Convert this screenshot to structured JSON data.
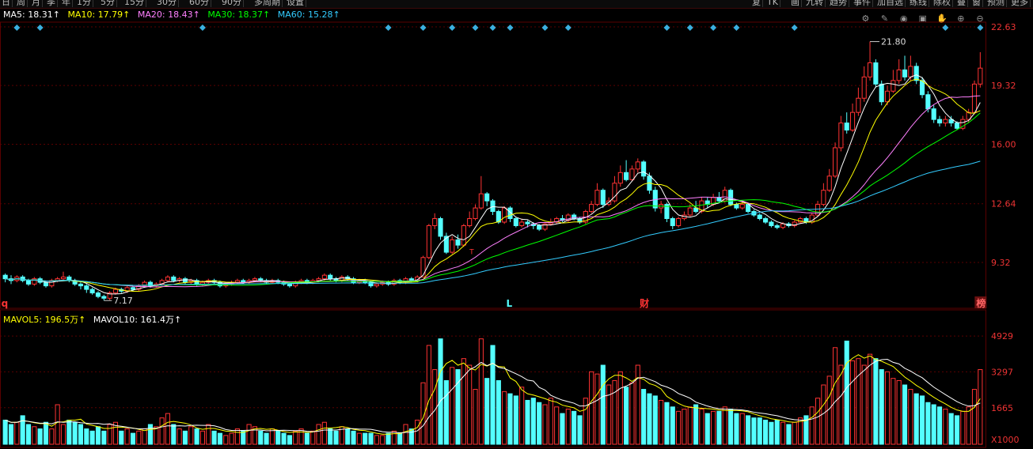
{
  "toolbar": {
    "left_items": [
      "日",
      "周",
      "月",
      "季",
      "年",
      "1分",
      "5分",
      "15分",
      "30分",
      "60分",
      "90分",
      "多周期",
      "设置"
    ],
    "right_items": [
      "复",
      "TK",
      "画",
      "九转",
      "趋势",
      "事件",
      "加自选",
      "练线",
      "除权",
      "叠",
      "窗",
      "预测",
      "更多"
    ]
  },
  "ma_legend": {
    "ma5": "MA5: 18.31↑",
    "ma10": "MA10: 17.79↑",
    "ma20": "MA20: 18.43↑",
    "ma30": "MA30: 18.37↑",
    "ma60": "MA60: 15.28↑"
  },
  "vol_legend": {
    "mavol5": "MAVOL5: 196.5万↑",
    "mavol10": "MAVOL10: 161.4万↑"
  },
  "price_axis": [
    "22.63",
    "19.32",
    "16.00",
    "12.64",
    "9.32"
  ],
  "vol_axis": [
    "4929",
    "3297",
    "1665",
    "X1000"
  ],
  "annotations": {
    "high_label": "21.80",
    "low_label": "7.17",
    "marker_q": "q",
    "marker_l": "L",
    "marker_cai": "财",
    "marker_bang": "榜",
    "marker_t": "T"
  },
  "colors": {
    "up": "#ff3333",
    "down": "#54ffff",
    "ma5": "#ffffff",
    "ma10": "#ffff00",
    "ma20": "#ff80ff",
    "ma30": "#00ff00",
    "ma60": "#33ccff",
    "grid": "#5a0000"
  },
  "icons": [
    "settings-icon",
    "pen-icon",
    "eye-icon",
    "bag-icon",
    "hand-icon",
    "zoom-in-icon",
    "zoom-out-icon"
  ],
  "chart_data": {
    "type": "candlestick",
    "price_axis_ticks": [
      9.32,
      12.64,
      16.0,
      19.32,
      22.63
    ],
    "volume_axis_ticks": [
      1665,
      3297,
      4929
    ],
    "volume_unit": "X1000",
    "candles": [
      [
        8.6,
        8.4,
        8.7,
        8.2,
        1100
      ],
      [
        8.4,
        8.3,
        8.6,
        8.1,
        900
      ],
      [
        8.3,
        8.5,
        8.6,
        8.2,
        1000
      ],
      [
        8.5,
        8.3,
        8.6,
        8.2,
        1300
      ],
      [
        8.3,
        8.1,
        8.4,
        8.0,
        900
      ],
      [
        8.1,
        8.4,
        8.5,
        8.0,
        800
      ],
      [
        8.4,
        8.2,
        8.5,
        8.1,
        700
      ],
      [
        8.2,
        8.0,
        8.3,
        7.9,
        1000
      ],
      [
        8.0,
        8.3,
        8.4,
        7.9,
        700
      ],
      [
        8.3,
        8.4,
        8.5,
        8.2,
        1800
      ],
      [
        8.4,
        8.5,
        8.8,
        8.3,
        900
      ],
      [
        8.5,
        8.3,
        8.6,
        8.2,
        1100
      ],
      [
        8.3,
        8.1,
        8.4,
        8.0,
        1000
      ],
      [
        8.1,
        8.0,
        8.2,
        7.8,
        900
      ],
      [
        8.0,
        7.8,
        8.1,
        7.6,
        700
      ],
      [
        7.8,
        7.6,
        7.9,
        7.5,
        600
      ],
      [
        7.6,
        7.4,
        7.7,
        7.3,
        800
      ],
      [
        7.4,
        7.3,
        7.5,
        7.17,
        600
      ],
      [
        7.3,
        7.6,
        7.7,
        7.2,
        900
      ],
      [
        7.6,
        7.8,
        7.9,
        7.5,
        1000
      ],
      [
        7.8,
        7.7,
        7.9,
        7.6,
        600
      ],
      [
        7.7,
        7.9,
        8.0,
        7.6,
        700
      ],
      [
        7.9,
        7.8,
        8.0,
        7.7,
        500
      ],
      [
        7.8,
        8.0,
        8.1,
        7.7,
        600
      ],
      [
        8.0,
        8.2,
        8.3,
        7.9,
        700
      ],
      [
        8.2,
        8.0,
        8.3,
        7.9,
        900
      ],
      [
        8.0,
        8.1,
        8.2,
        7.9,
        800
      ],
      [
        8.1,
        8.3,
        8.4,
        8.0,
        1200
      ],
      [
        8.3,
        8.5,
        8.6,
        8.2,
        1400
      ],
      [
        8.5,
        8.3,
        8.6,
        8.2,
        900
      ],
      [
        8.3,
        8.4,
        8.5,
        8.2,
        700
      ],
      [
        8.4,
        8.2,
        8.5,
        8.1,
        600
      ],
      [
        8.2,
        8.3,
        8.4,
        8.1,
        800
      ],
      [
        8.3,
        8.1,
        8.4,
        8.0,
        700
      ],
      [
        8.1,
        8.2,
        8.3,
        8.0,
        600
      ],
      [
        8.2,
        8.3,
        8.4,
        8.1,
        900
      ],
      [
        8.3,
        8.2,
        8.4,
        8.1,
        600
      ],
      [
        8.2,
        8.0,
        8.3,
        7.9,
        500
      ],
      [
        8.0,
        8.1,
        8.2,
        7.9,
        400
      ],
      [
        8.1,
        8.2,
        8.3,
        8.0,
        500
      ],
      [
        8.2,
        8.3,
        8.4,
        8.1,
        700
      ],
      [
        8.3,
        8.2,
        8.4,
        8.1,
        600
      ],
      [
        8.2,
        8.3,
        8.4,
        8.1,
        900
      ],
      [
        8.3,
        8.4,
        8.5,
        8.2,
        800
      ],
      [
        8.4,
        8.3,
        8.5,
        8.2,
        600
      ],
      [
        8.3,
        8.2,
        8.4,
        8.1,
        500
      ],
      [
        8.2,
        8.3,
        8.4,
        8.1,
        700
      ],
      [
        8.3,
        8.2,
        8.4,
        8.1,
        600
      ],
      [
        8.2,
        8.1,
        8.3,
        8.0,
        500
      ],
      [
        8.1,
        8.0,
        8.2,
        7.9,
        400
      ],
      [
        8.0,
        8.2,
        8.3,
        7.9,
        600
      ],
      [
        8.2,
        8.3,
        8.4,
        8.1,
        700
      ],
      [
        8.3,
        8.2,
        8.4,
        8.1,
        500
      ],
      [
        8.2,
        8.3,
        8.4,
        8.1,
        600
      ],
      [
        8.3,
        8.4,
        8.5,
        8.2,
        900
      ],
      [
        8.4,
        8.6,
        8.7,
        8.3,
        1000
      ],
      [
        8.6,
        8.4,
        8.7,
        8.3,
        700
      ],
      [
        8.4,
        8.3,
        8.5,
        8.2,
        600
      ],
      [
        8.3,
        8.5,
        8.6,
        8.2,
        800
      ],
      [
        8.5,
        8.4,
        8.6,
        8.3,
        700
      ],
      [
        8.4,
        8.2,
        8.5,
        8.1,
        600
      ],
      [
        8.2,
        8.3,
        8.4,
        8.1,
        500
      ],
      [
        8.3,
        8.2,
        8.4,
        8.1,
        500
      ],
      [
        8.2,
        8.0,
        8.3,
        7.9,
        500
      ],
      [
        8.0,
        8.1,
        8.2,
        7.9,
        400
      ],
      [
        8.1,
        8.2,
        8.3,
        8.0,
        400
      ],
      [
        8.2,
        8.1,
        8.3,
        8.0,
        500
      ],
      [
        8.1,
        8.3,
        8.4,
        8.0,
        600
      ],
      [
        8.3,
        8.2,
        8.4,
        8.1,
        500
      ],
      [
        8.2,
        8.4,
        8.5,
        8.1,
        900
      ],
      [
        8.4,
        8.3,
        8.5,
        8.2,
        700
      ],
      [
        8.3,
        8.5,
        8.6,
        8.2,
        1100
      ],
      [
        8.5,
        9.6,
        9.7,
        8.5,
        2800
      ],
      [
        9.6,
        11.4,
        11.5,
        9.5,
        4500
      ],
      [
        11.4,
        11.8,
        12.1,
        11.2,
        3400
      ],
      [
        11.8,
        10.8,
        11.9,
        10.6,
        4800
      ],
      [
        10.8,
        9.9,
        11.0,
        9.8,
        2900
      ],
      [
        9.9,
        10.6,
        10.8,
        9.8,
        3500
      ],
      [
        10.6,
        10.3,
        10.9,
        10.1,
        3400
      ],
      [
        10.3,
        11.4,
        11.5,
        10.2,
        3900
      ],
      [
        11.4,
        11.8,
        12.2,
        11.3,
        3600
      ],
      [
        11.8,
        12.4,
        12.6,
        11.7,
        2500
      ],
      [
        12.4,
        13.2,
        14.2,
        12.3,
        4800
      ],
      [
        13.2,
        12.8,
        13.3,
        12.5,
        3000
      ],
      [
        12.8,
        12.2,
        12.9,
        12.0,
        4500
      ],
      [
        12.2,
        11.6,
        12.3,
        11.5,
        2900
      ],
      [
        11.6,
        12.4,
        12.5,
        11.5,
        2400
      ],
      [
        12.4,
        11.8,
        12.5,
        11.6,
        2300
      ],
      [
        11.8,
        11.4,
        11.9,
        11.3,
        2200
      ],
      [
        11.4,
        11.6,
        11.8,
        11.3,
        2600
      ],
      [
        11.6,
        11.5,
        11.7,
        11.3,
        2000
      ],
      [
        11.5,
        11.4,
        11.6,
        11.2,
        2100
      ],
      [
        11.4,
        11.2,
        11.5,
        11.1,
        1900
      ],
      [
        11.2,
        11.5,
        11.6,
        11.1,
        1800
      ],
      [
        11.5,
        11.6,
        11.8,
        11.4,
        2100
      ],
      [
        11.6,
        11.8,
        11.9,
        11.5,
        1700
      ],
      [
        11.8,
        11.7,
        12.0,
        11.6,
        1400
      ],
      [
        11.7,
        12.0,
        12.1,
        11.6,
        1600
      ],
      [
        12.0,
        11.8,
        12.1,
        11.7,
        1500
      ],
      [
        11.8,
        11.6,
        11.9,
        11.5,
        1300
      ],
      [
        11.6,
        12.2,
        12.3,
        11.5,
        2100
      ],
      [
        12.2,
        12.6,
        12.8,
        12.1,
        3300
      ],
      [
        12.6,
        13.4,
        13.8,
        12.5,
        3200
      ],
      [
        13.4,
        12.6,
        13.5,
        12.4,
        3600
      ],
      [
        12.6,
        12.8,
        13.0,
        12.5,
        2700
      ],
      [
        12.8,
        13.8,
        14.2,
        12.7,
        2900
      ],
      [
        13.8,
        14.4,
        14.8,
        13.6,
        3300
      ],
      [
        14.4,
        14.0,
        15.1,
        13.9,
        2600
      ],
      [
        14.0,
        14.6,
        14.8,
        13.9,
        2800
      ],
      [
        14.6,
        15.0,
        15.2,
        14.4,
        3600
      ],
      [
        15.0,
        14.2,
        15.1,
        14.0,
        2500
      ],
      [
        14.2,
        13.4,
        14.4,
        13.2,
        2300
      ],
      [
        13.4,
        12.4,
        13.6,
        12.2,
        2200
      ],
      [
        12.4,
        12.6,
        12.8,
        12.1,
        2000
      ],
      [
        12.6,
        11.8,
        12.7,
        11.6,
        1900
      ],
      [
        11.8,
        11.4,
        11.9,
        11.2,
        1700
      ],
      [
        11.4,
        11.8,
        11.9,
        11.3,
        1500
      ],
      [
        11.8,
        12.0,
        12.2,
        11.7,
        1600
      ],
      [
        12.0,
        12.4,
        12.6,
        11.9,
        1700
      ],
      [
        12.4,
        12.2,
        12.8,
        12.1,
        1800
      ],
      [
        12.2,
        12.8,
        13.0,
        12.1,
        1600
      ],
      [
        12.8,
        12.6,
        13.0,
        12.4,
        1400
      ],
      [
        12.6,
        13.0,
        13.2,
        12.5,
        1500
      ],
      [
        13.0,
        12.8,
        13.3,
        12.7,
        1500
      ],
      [
        12.8,
        13.4,
        13.6,
        12.7,
        1700
      ],
      [
        13.4,
        12.6,
        13.5,
        12.5,
        1600
      ],
      [
        12.6,
        12.4,
        12.7,
        12.3,
        1400
      ],
      [
        12.4,
        12.6,
        12.8,
        12.3,
        1400
      ],
      [
        12.6,
        12.2,
        12.7,
        12.1,
        1300
      ],
      [
        12.2,
        12.0,
        12.3,
        11.9,
        1200
      ],
      [
        12.0,
        11.8,
        12.1,
        11.7,
        1200
      ],
      [
        11.8,
        11.6,
        11.9,
        11.5,
        1100
      ],
      [
        11.6,
        11.4,
        11.7,
        11.3,
        1000
      ],
      [
        11.4,
        11.3,
        11.5,
        11.2,
        1100
      ],
      [
        11.3,
        11.5,
        11.6,
        11.2,
        1000
      ],
      [
        11.5,
        11.4,
        11.6,
        11.3,
        900
      ],
      [
        11.4,
        11.6,
        11.7,
        11.3,
        1000
      ],
      [
        11.6,
        11.8,
        11.9,
        11.5,
        1200
      ],
      [
        11.8,
        11.6,
        11.9,
        11.5,
        1300
      ],
      [
        11.6,
        12.0,
        12.1,
        11.5,
        1700
      ],
      [
        12.0,
        12.6,
        12.8,
        11.9,
        2100
      ],
      [
        12.6,
        13.4,
        13.8,
        12.5,
        2700
      ],
      [
        13.4,
        14.2,
        14.6,
        13.3,
        3100
      ],
      [
        14.2,
        15.8,
        16.1,
        14.1,
        4400
      ],
      [
        15.8,
        17.2,
        17.6,
        15.6,
        3600
      ],
      [
        17.2,
        16.8,
        17.8,
        16.6,
        4700
      ],
      [
        16.8,
        17.8,
        18.3,
        16.7,
        3800
      ],
      [
        17.8,
        18.6,
        19.2,
        17.6,
        3900
      ],
      [
        18.6,
        19.8,
        20.4,
        18.4,
        3600
      ],
      [
        19.8,
        20.6,
        21.8,
        19.6,
        4100
      ],
      [
        20.6,
        19.4,
        20.8,
        19.2,
        3900
      ],
      [
        19.4,
        18.4,
        19.6,
        18.2,
        3400
      ],
      [
        18.4,
        19.0,
        19.3,
        18.2,
        3300
      ],
      [
        19.0,
        19.6,
        20.2,
        18.9,
        3000
      ],
      [
        19.6,
        20.2,
        20.8,
        19.4,
        2900
      ],
      [
        20.2,
        19.8,
        21.0,
        19.6,
        2700
      ],
      [
        19.8,
        20.4,
        21.0,
        19.6,
        2500
      ],
      [
        20.4,
        19.6,
        20.6,
        19.4,
        2300
      ],
      [
        19.6,
        18.8,
        19.8,
        18.6,
        2200
      ],
      [
        18.8,
        18.0,
        19.0,
        17.8,
        1900
      ],
      [
        18.0,
        17.4,
        18.2,
        17.2,
        1800
      ],
      [
        17.4,
        17.2,
        17.6,
        17.0,
        1700
      ],
      [
        17.2,
        17.4,
        17.6,
        17.0,
        1600
      ],
      [
        17.4,
        17.2,
        17.6,
        17.0,
        1400
      ],
      [
        17.2,
        16.9,
        17.3,
        16.8,
        1300
      ],
      [
        16.9,
        17.4,
        17.6,
        16.8,
        1500
      ],
      [
        17.4,
        17.8,
        18.0,
        17.2,
        1700
      ],
      [
        17.8,
        19.4,
        19.6,
        17.7,
        2500
      ],
      [
        19.4,
        20.3,
        21.2,
        19.2,
        3400
      ]
    ],
    "event_markers": [
      {
        "index": 0,
        "label": "q",
        "color": "#ff3333"
      },
      {
        "index": 87,
        "label": "L",
        "color": "#54ffff"
      },
      {
        "index": 110,
        "label": "财",
        "color": "#ff3333"
      },
      {
        "index": 186,
        "label": "榜",
        "color": "#ff6666"
      }
    ],
    "high": 21.8,
    "low": 7.17
  }
}
